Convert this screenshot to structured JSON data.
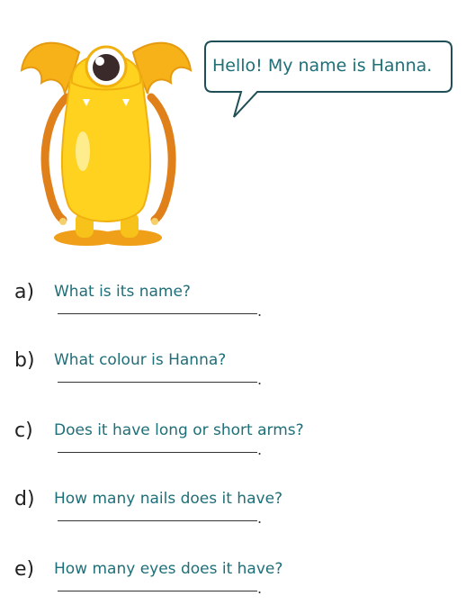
{
  "speech_bubble": {
    "text": "Hello! My name is Hanna."
  },
  "questions": [
    {
      "letter": "a)",
      "text": "What is its name?",
      "end_mark": "."
    },
    {
      "letter": "b)",
      "text": "What colour is Hanna?",
      "end_mark": "."
    },
    {
      "letter": "c)",
      "text": "Does it have long or short arms?",
      "end_mark": "."
    },
    {
      "letter": "d)",
      "text": "How many nails does it have?",
      "end_mark": "."
    },
    {
      "letter": "e)",
      "text": "How many eyes does it have?",
      "end_mark": "."
    }
  ],
  "colors": {
    "text_teal": "#1f6f78",
    "monster_yellow": "#ffd21f",
    "monster_orange": "#f0a018"
  }
}
